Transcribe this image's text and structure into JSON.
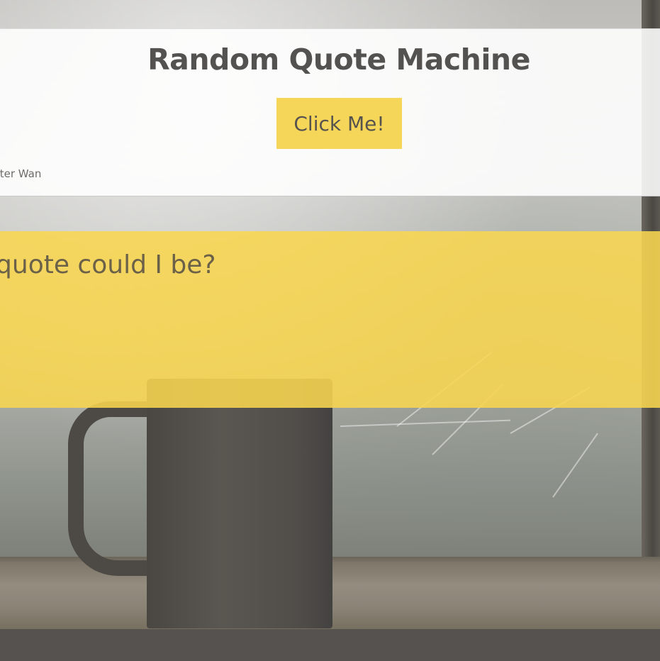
{
  "header": {
    "title": "Random Quote Machine",
    "button_label": "Click Me!",
    "author_credit": "Peter Wan"
  },
  "quote": {
    "text": "What quote could I be?"
  },
  "colors": {
    "accent_yellow": "#f6d659",
    "text_dark": "#545250",
    "panel_white": "rgba(255,255,255,0.88)"
  }
}
